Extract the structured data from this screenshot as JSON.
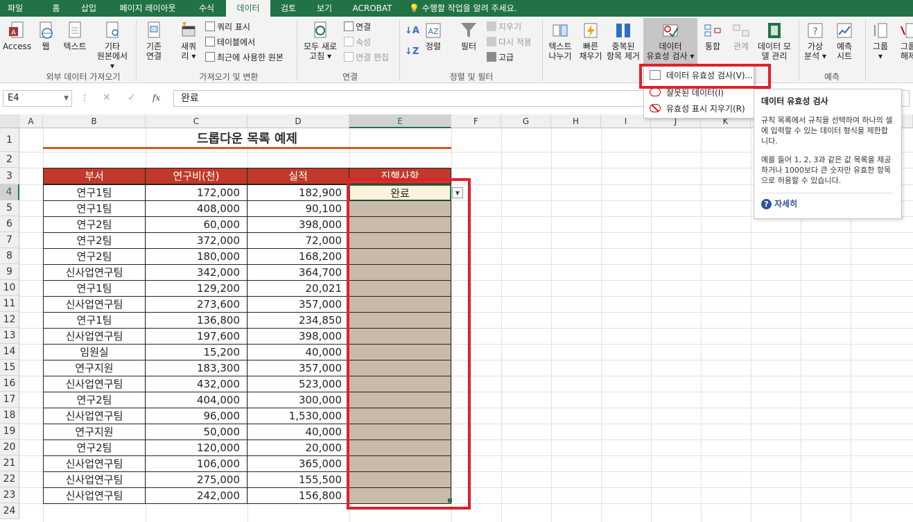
{
  "tabs": [
    "파일",
    "홈",
    "삽입",
    "페이지 레이아웃",
    "수식",
    "데이터",
    "검토",
    "보기",
    "ACROBAT"
  ],
  "tell_me": "수행할 작업을 알려 주세요.",
  "ribbon": {
    "groups": [
      "외부 데이터 가져오기",
      "가져오기 및 변환",
      "연결",
      "정렬 및 필터",
      "예측"
    ],
    "external": {
      "access": "Access",
      "web": "웹",
      "text": "텍스트",
      "other_1": "기타",
      "other_2": "원본에서"
    },
    "get_transform": {
      "existing_1": "기존",
      "existing_2": "연결",
      "new_query_1": "새쿼",
      "new_query_2": "리",
      "show_queries": "쿼리 표시",
      "from_table": "테이블에서",
      "recent_sources": "최근에 사용한 원본"
    },
    "connections": {
      "refresh_1": "모두 새로",
      "refresh_2": "고침",
      "connections": "연결",
      "properties": "속성",
      "edit_links": "연결 편집"
    },
    "sort_filter": {
      "sort": "정렬",
      "filter": "필터",
      "clear": "지우기",
      "reapply": "다시 적용",
      "advanced": "고급"
    },
    "data_tools": {
      "text_to_columns_1": "텍스트",
      "text_to_columns_2": "나누기",
      "flash_fill_1": "빠른",
      "flash_fill_2": "채우기",
      "remove_dup_1": "중복된",
      "remove_dup_2": "항목 제거",
      "validation_1": "데이터",
      "validation_2": "유효성 검사",
      "consolidate": "통합",
      "relationships": "관계",
      "data_model_1": "데이터 모",
      "data_model_2": "델 관리"
    },
    "forecast": {
      "whatif_1": "가상",
      "whatif_2": "분석",
      "sheet_1": "예측",
      "sheet_2": "시트"
    },
    "outline": {
      "group": "그룹",
      "ungroup_1": "그룹",
      "ungroup_2": "해제"
    }
  },
  "formula_bar": {
    "name_box": "E4",
    "fx": "fx",
    "value": "완료"
  },
  "columns": [
    "A",
    "B",
    "C",
    "D",
    "E",
    "F",
    "G",
    "H",
    "I",
    "J",
    "K"
  ],
  "rows": [
    "1",
    "2",
    "3",
    "4",
    "5",
    "6",
    "7",
    "8",
    "9",
    "10",
    "11",
    "12",
    "13",
    "14",
    "15",
    "16",
    "17",
    "18",
    "19",
    "20",
    "21",
    "22",
    "23",
    "24"
  ],
  "sheet": {
    "title": "드롭다운 목록 예제",
    "headers": [
      "부서",
      "연구비(천)",
      "실적",
      "진행사항"
    ],
    "data": [
      [
        "연구1팀",
        "172,000",
        "182,900",
        "완료"
      ],
      [
        "연구1팀",
        "408,000",
        "90,100",
        ""
      ],
      [
        "연구2팀",
        "60,000",
        "398,000",
        ""
      ],
      [
        "연구2팀",
        "372,000",
        "72,000",
        ""
      ],
      [
        "연구2팀",
        "180,000",
        "168,200",
        ""
      ],
      [
        "신사업연구팀",
        "342,000",
        "364,700",
        ""
      ],
      [
        "연구1팀",
        "129,200",
        "20,021",
        ""
      ],
      [
        "신사업연구팀",
        "273,600",
        "357,000",
        ""
      ],
      [
        "연구1팀",
        "136,800",
        "234,850",
        ""
      ],
      [
        "신사업연구팀",
        "197,600",
        "398,000",
        ""
      ],
      [
        "임원실",
        "15,200",
        "40,000",
        ""
      ],
      [
        "연구지원",
        "183,300",
        "357,000",
        ""
      ],
      [
        "신사업연구팀",
        "432,000",
        "523,000",
        ""
      ],
      [
        "연구2팀",
        "404,000",
        "300,000",
        ""
      ],
      [
        "신사업연구팀",
        "96,000",
        "1,530,000",
        ""
      ],
      [
        "연구지원",
        "50,000",
        "40,000",
        ""
      ],
      [
        "연구2팀",
        "120,000",
        "20,000",
        ""
      ],
      [
        "신사업연구팀",
        "106,000",
        "365,000",
        ""
      ],
      [
        "신사업연구팀",
        "275,000",
        "155,500",
        ""
      ],
      [
        "신사업연구팀",
        "242,000",
        "156,800",
        ""
      ]
    ]
  },
  "menu": {
    "items": [
      "데이터 유효성 검사(V)...",
      "잘못된 데이터(I)",
      "유효성 표시 지우기(R)"
    ]
  },
  "tooltip": {
    "title": "데이터 유효성 검사",
    "para1": "규칙 목록에서 규칙을 선택하여 하나의 셀에 입력할 수 있는 데이터 형식을 제한합니다.",
    "para2": "예를 들어 1, 2, 3과 같은 값 목록을 제공하거나 1000보다 큰 숫자만 유효한 항목으로 허용할 수 있습니다.",
    "more": "자세히"
  },
  "colors": {
    "accent": "#217346",
    "header_fill": "#c0392b",
    "range_fill": "#c8bba9",
    "highlight": "#e0202a",
    "selected_cell_fill": "#fdf2dc"
  }
}
